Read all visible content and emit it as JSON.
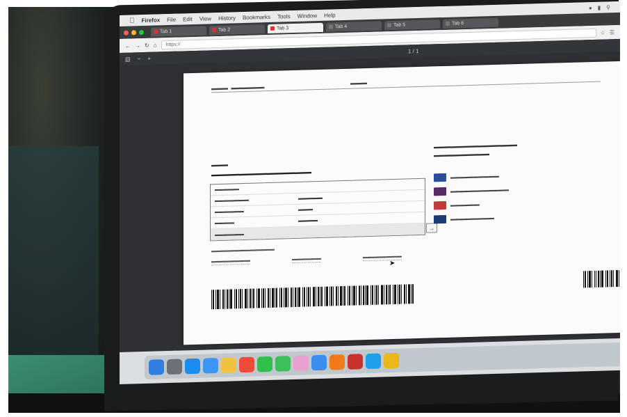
{
  "menubar": {
    "app_name": "Firefox",
    "items": [
      "File",
      "Edit",
      "View",
      "History",
      "Bookmarks",
      "Tools",
      "Window",
      "Help"
    ]
  },
  "browser": {
    "tabs": [
      "Tab 1",
      "Tab 2",
      "Tab 3",
      "Tab 4",
      "Tab 5",
      "Tab 6"
    ],
    "address_placeholder": "https://"
  },
  "pdf_viewer": {
    "page_indicator": "1 / 1"
  },
  "document": {
    "barcode_caption": "",
    "right_barcode_caption": ""
  },
  "dock": {
    "icons": [
      "finder-icon",
      "launchpad-icon",
      "safari-icon",
      "mail-icon",
      "notes-icon",
      "calendar-icon",
      "messages-icon",
      "facetime-icon",
      "photos-icon",
      "appstore-icon",
      "firefox-icon",
      "filezilla-icon",
      "skype-icon",
      "chrome-icon"
    ]
  },
  "colors": {
    "screen_bg": "#dcdfe2",
    "viewer_bg": "#2f3033",
    "page_bg": "#fbfbfb",
    "desk": "#2a6a56"
  }
}
